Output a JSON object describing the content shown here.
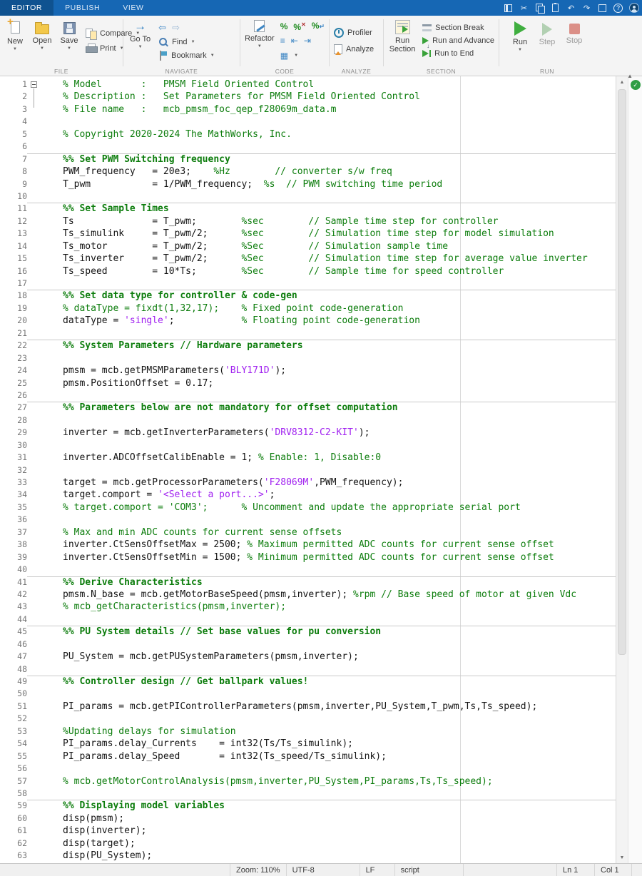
{
  "tabbar": {
    "tabs": [
      "EDITOR",
      "PUBLISH",
      "VIEW"
    ],
    "quick_access_icons": [
      "save",
      "cut",
      "copy",
      "paste",
      "undo",
      "redo",
      "switch-windows",
      "help",
      "account"
    ]
  },
  "toolstrip": {
    "file": {
      "label": "FILE",
      "new": "New",
      "open": "Open",
      "save": "Save",
      "compare": "Compare",
      "print": "Print"
    },
    "navigate": {
      "label": "NAVIGATE",
      "goto": "Go To",
      "find": "Find",
      "bookmark": "Bookmark"
    },
    "code": {
      "label": "CODE",
      "refactor": "Refactor"
    },
    "analyze": {
      "label": "ANALYZE",
      "profiler": "Profiler",
      "analyze": "Analyze"
    },
    "section": {
      "label": "SECTION",
      "run_line1": "Run",
      "run_line2": "Section",
      "section_break": "Section Break",
      "run_and_advance": "Run and Advance",
      "run_to_end": "Run to End"
    },
    "run": {
      "label": "RUN",
      "run": "Run",
      "step": "Step",
      "stop": "Stop"
    }
  },
  "statusbar": {
    "zoom": "Zoom: 110%",
    "encoding": "UTF-8",
    "line_ending": "LF",
    "file_type": "script",
    "line": "Ln 1",
    "column": "Col 1"
  },
  "editor": {
    "analyzer_status": "clean",
    "colors": {
      "comment_green": "#0d7d0d",
      "string_purple": "#a020f0",
      "code_black": "#141414",
      "toolstrip_blue": "#1667b4"
    },
    "lines": [
      {
        "n": 1,
        "fold": true,
        "tokens": [
          {
            "t": "comment",
            "s": "% Model       :   PMSM Field Oriented Control"
          }
        ]
      },
      {
        "n": 2,
        "tokens": [
          {
            "t": "comment",
            "s": "% Description :   Set Parameters for PMSM Field Oriented Control"
          }
        ]
      },
      {
        "n": 3,
        "tokens": [
          {
            "t": "comment",
            "s": "% File name   :   mcb_pmsm_foc_qep_f28069m_data.m"
          }
        ]
      },
      {
        "n": 4,
        "tokens": []
      },
      {
        "n": 5,
        "tokens": [
          {
            "t": "comment",
            "s": "% Copyright 2020-2024 The MathWorks, Inc."
          }
        ]
      },
      {
        "n": 6,
        "tokens": []
      },
      {
        "n": 7,
        "section_start": true,
        "tokens": [
          {
            "t": "section",
            "s": "%% Set PWM Switching frequency"
          }
        ]
      },
      {
        "n": 8,
        "tokens": [
          {
            "t": "code",
            "s": "PWM_frequency   = 20e3;    "
          },
          {
            "t": "comment",
            "s": "%Hz        // converter s/w freq"
          }
        ]
      },
      {
        "n": 9,
        "tokens": [
          {
            "t": "code",
            "s": "T_pwm           = 1/PWM_frequency;  "
          },
          {
            "t": "comment",
            "s": "%s  // PWM switching time period"
          }
        ]
      },
      {
        "n": 10,
        "tokens": []
      },
      {
        "n": 11,
        "section_start": true,
        "tokens": [
          {
            "t": "section",
            "s": "%% Set Sample Times"
          }
        ]
      },
      {
        "n": 12,
        "tokens": [
          {
            "t": "code",
            "s": "Ts              = T_pwm;        "
          },
          {
            "t": "comment",
            "s": "%sec        // Sample time step for controller"
          }
        ]
      },
      {
        "n": 13,
        "tokens": [
          {
            "t": "code",
            "s": "Ts_simulink     = T_pwm/2;      "
          },
          {
            "t": "comment",
            "s": "%sec        // Simulation time step for model simulation"
          }
        ]
      },
      {
        "n": 14,
        "tokens": [
          {
            "t": "code",
            "s": "Ts_motor        = T_pwm/2;      "
          },
          {
            "t": "comment",
            "s": "%Sec        // Simulation sample time"
          }
        ]
      },
      {
        "n": 15,
        "tokens": [
          {
            "t": "code",
            "s": "Ts_inverter     = T_pwm/2;      "
          },
          {
            "t": "comment",
            "s": "%Sec        // Simulation time step for average value inverter"
          }
        ]
      },
      {
        "n": 16,
        "tokens": [
          {
            "t": "code",
            "s": "Ts_speed        = 10*Ts;        "
          },
          {
            "t": "comment",
            "s": "%Sec        // Sample time for speed controller"
          }
        ]
      },
      {
        "n": 17,
        "tokens": []
      },
      {
        "n": 18,
        "section_start": true,
        "tokens": [
          {
            "t": "section",
            "s": "%% Set data type for controller & code-gen"
          }
        ]
      },
      {
        "n": 19,
        "tokens": [
          {
            "t": "comment",
            "s": "% dataType = fixdt(1,32,17);    % Fixed point code-generation"
          }
        ]
      },
      {
        "n": 20,
        "tokens": [
          {
            "t": "code",
            "s": "dataType = "
          },
          {
            "t": "string",
            "s": "'single'"
          },
          {
            "t": "code",
            "s": ";            "
          },
          {
            "t": "comment",
            "s": "% Floating point code-generation"
          }
        ]
      },
      {
        "n": 21,
        "tokens": []
      },
      {
        "n": 22,
        "section_start": true,
        "tokens": [
          {
            "t": "section",
            "s": "%% System Parameters // Hardware parameters"
          }
        ]
      },
      {
        "n": 23,
        "tokens": []
      },
      {
        "n": 24,
        "tokens": [
          {
            "t": "code",
            "s": "pmsm = mcb.getPMSMParameters("
          },
          {
            "t": "string",
            "s": "'BLY171D'"
          },
          {
            "t": "code",
            "s": ");"
          }
        ]
      },
      {
        "n": 25,
        "tokens": [
          {
            "t": "code",
            "s": "pmsm.PositionOffset = 0.17;"
          }
        ]
      },
      {
        "n": 26,
        "tokens": []
      },
      {
        "n": 27,
        "section_start": true,
        "tokens": [
          {
            "t": "section",
            "s": "%% Parameters below are not mandatory for offset computation"
          }
        ]
      },
      {
        "n": 28,
        "tokens": []
      },
      {
        "n": 29,
        "tokens": [
          {
            "t": "code",
            "s": "inverter = mcb.getInverterParameters("
          },
          {
            "t": "string",
            "s": "'DRV8312-C2-KIT'"
          },
          {
            "t": "code",
            "s": ");"
          }
        ]
      },
      {
        "n": 30,
        "tokens": []
      },
      {
        "n": 31,
        "tokens": [
          {
            "t": "code",
            "s": "inverter.ADCOffsetCalibEnable = 1; "
          },
          {
            "t": "comment",
            "s": "% Enable: 1, Disable:0"
          }
        ]
      },
      {
        "n": 32,
        "tokens": []
      },
      {
        "n": 33,
        "tokens": [
          {
            "t": "code",
            "s": "target = mcb.getProcessorParameters("
          },
          {
            "t": "string",
            "s": "'F28069M'"
          },
          {
            "t": "code",
            "s": ",PWM_frequency);"
          }
        ]
      },
      {
        "n": 34,
        "tokens": [
          {
            "t": "code",
            "s": "target.comport = "
          },
          {
            "t": "string",
            "s": "'<Select a port...>'"
          },
          {
            "t": "code",
            "s": ";"
          }
        ]
      },
      {
        "n": 35,
        "tokens": [
          {
            "t": "comment",
            "s": "% target.comport = 'COM3';      % Uncomment and update the appropriate serial port"
          }
        ]
      },
      {
        "n": 36,
        "tokens": []
      },
      {
        "n": 37,
        "tokens": [
          {
            "t": "comment",
            "s": "% Max and min ADC counts for current sense offsets"
          }
        ]
      },
      {
        "n": 38,
        "tokens": [
          {
            "t": "code",
            "s": "inverter.CtSensOffsetMax = 2500; "
          },
          {
            "t": "comment",
            "s": "% Maximum permitted ADC counts for current sense offset"
          }
        ]
      },
      {
        "n": 39,
        "tokens": [
          {
            "t": "code",
            "s": "inverter.CtSensOffsetMin = 1500; "
          },
          {
            "t": "comment",
            "s": "% Minimum permitted ADC counts for current sense offset"
          }
        ]
      },
      {
        "n": 40,
        "tokens": []
      },
      {
        "n": 41,
        "section_start": true,
        "tokens": [
          {
            "t": "section",
            "s": "%% Derive Characteristics"
          }
        ]
      },
      {
        "n": 42,
        "tokens": [
          {
            "t": "code",
            "s": "pmsm.N_base = mcb.getMotorBaseSpeed(pmsm,inverter); "
          },
          {
            "t": "comment",
            "s": "%rpm // Base speed of motor at given Vdc"
          }
        ]
      },
      {
        "n": 43,
        "tokens": [
          {
            "t": "comment",
            "s": "% mcb_getCharacteristics(pmsm,inverter);"
          }
        ]
      },
      {
        "n": 44,
        "tokens": []
      },
      {
        "n": 45,
        "section_start": true,
        "tokens": [
          {
            "t": "section",
            "s": "%% PU System details // Set base values for pu conversion"
          }
        ]
      },
      {
        "n": 46,
        "tokens": []
      },
      {
        "n": 47,
        "tokens": [
          {
            "t": "code",
            "s": "PU_System = mcb.getPUSystemParameters(pmsm,inverter);"
          }
        ]
      },
      {
        "n": 48,
        "tokens": []
      },
      {
        "n": 49,
        "section_start": true,
        "tokens": [
          {
            "t": "section",
            "s": "%% Controller design // Get ballpark values!"
          }
        ]
      },
      {
        "n": 50,
        "tokens": []
      },
      {
        "n": 51,
        "tokens": [
          {
            "t": "code",
            "s": "PI_params = mcb.getPIControllerParameters(pmsm,inverter,PU_System,T_pwm,Ts,Ts_speed);"
          }
        ]
      },
      {
        "n": 52,
        "tokens": []
      },
      {
        "n": 53,
        "tokens": [
          {
            "t": "comment",
            "s": "%Updating delays for simulation"
          }
        ]
      },
      {
        "n": 54,
        "tokens": [
          {
            "t": "code",
            "s": "PI_params.delay_Currents    = int32(Ts/Ts_simulink);"
          }
        ]
      },
      {
        "n": 55,
        "tokens": [
          {
            "t": "code",
            "s": "PI_params.delay_Speed       = int32(Ts_speed/Ts_simulink);"
          }
        ]
      },
      {
        "n": 56,
        "tokens": []
      },
      {
        "n": 57,
        "tokens": [
          {
            "t": "comment",
            "s": "% mcb.getMotorControlAnalysis(pmsm,inverter,PU_System,PI_params,Ts,Ts_speed);"
          }
        ]
      },
      {
        "n": 58,
        "tokens": []
      },
      {
        "n": 59,
        "section_start": true,
        "tokens": [
          {
            "t": "section",
            "s": "%% Displaying model variables"
          }
        ]
      },
      {
        "n": 60,
        "tokens": [
          {
            "t": "code",
            "s": "disp(pmsm);"
          }
        ]
      },
      {
        "n": 61,
        "tokens": [
          {
            "t": "code",
            "s": "disp(inverter);"
          }
        ]
      },
      {
        "n": 62,
        "tokens": [
          {
            "t": "code",
            "s": "disp(target);"
          }
        ]
      },
      {
        "n": 63,
        "tokens": [
          {
            "t": "code",
            "s": "disp(PU_System);"
          }
        ]
      }
    ]
  }
}
